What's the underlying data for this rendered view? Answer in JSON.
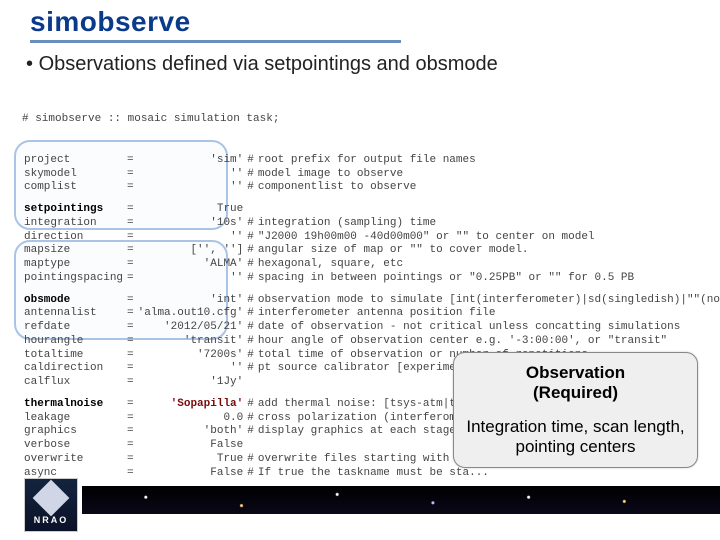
{
  "slide": {
    "title": "simobserve",
    "bullet": "Observations defined via setpointings and obsmode"
  },
  "header_comment": "# simobserve :: mosaic simulation task;",
  "params": [
    {
      "key": "project",
      "val": "'sim'",
      "comment": "root prefix for output file names",
      "indent": false,
      "bold": false
    },
    {
      "key": "skymodel",
      "val": "''",
      "comment": "model image to observe",
      "indent": false,
      "bold": false
    },
    {
      "key": "complist",
      "val": "''",
      "comment": "componentlist to observe",
      "indent": false,
      "bold": false
    }
  ],
  "group1": [
    {
      "key": "setpointings",
      "val": "True",
      "comment": "",
      "indent": false,
      "bold": true
    },
    {
      "key": "integration",
      "val": "'10s'",
      "comment": "integration (sampling) time",
      "indent": true,
      "bold": false
    },
    {
      "key": "direction",
      "val": "''",
      "comment": "\"J2000 19h00m00 -40d00m00\" or \"\" to center on model",
      "indent": true,
      "bold": false
    },
    {
      "key": "mapsize",
      "val": "['', '']",
      "comment": "angular size of map or \"\" to cover model.",
      "indent": true,
      "bold": false
    },
    {
      "key": "maptype",
      "val": "'ALMA'",
      "comment": "hexagonal, square, etc",
      "indent": true,
      "bold": false
    },
    {
      "key": "pointingspacing",
      "val": "''",
      "comment": "spacing in between pointings or \"0.25PB\" or \"\" for 0.5 PB",
      "indent": true,
      "bold": false
    }
  ],
  "group2": [
    {
      "key": "obsmode",
      "val": "'int'",
      "comment": "observation mode to simulate [int(interferometer)|sd(singledish)|\"\"(none)]",
      "indent": false,
      "bold": true
    },
    {
      "key": "antennalist",
      "val": "'alma.out10.cfg'",
      "comment": "interferometer antenna position file",
      "indent": true,
      "bold": false
    },
    {
      "key": "refdate",
      "val": "'2012/05/21'",
      "comment": "date of observation - not critical unless concatting simulations",
      "indent": true,
      "bold": false
    },
    {
      "key": "hourangle",
      "val": "'transit'",
      "comment": "hour angle of observation center e.g. '-3:00:00', or \"transit\"",
      "indent": true,
      "bold": false
    },
    {
      "key": "totaltime",
      "val": "'7200s'",
      "comment": "total time of observation or number of repetitions",
      "indent": true,
      "bold": false
    },
    {
      "key": "caldirection",
      "val": "''",
      "comment": "pt source calibrator [experimental]",
      "indent": true,
      "bold": false
    },
    {
      "key": "calflux",
      "val": "'1Jy'",
      "comment": "",
      "indent": true,
      "bold": false
    }
  ],
  "group3": [
    {
      "key": "thermalnoise",
      "val": "'Sopapilla'",
      "comment": "add thermal noise: [tsys-atm|tsys...",
      "indent": false,
      "bold": true,
      "hval": true
    },
    {
      "key": "leakage",
      "val": "0.0",
      "comment": "cross polarization (interferometer...",
      "indent": false,
      "bold": false
    },
    {
      "key": "graphics",
      "val": "'both'",
      "comment": "display graphics at each stage to...",
      "indent": false,
      "bold": false
    },
    {
      "key": "verbose",
      "val": "False",
      "comment": "",
      "indent": false,
      "bold": false
    },
    {
      "key": "overwrite",
      "val": "True",
      "comment": "overwrite files starting with $pr...",
      "indent": false,
      "bold": false
    },
    {
      "key": "async",
      "val": "False",
      "comment": "If true the taskname must be sta...",
      "indent": false,
      "bold": false
    }
  ],
  "callout": {
    "title1": "Observation",
    "title2": "(Required)",
    "body": "Integration time, scan length, pointing centers"
  },
  "logo": {
    "text": "NRAO"
  }
}
